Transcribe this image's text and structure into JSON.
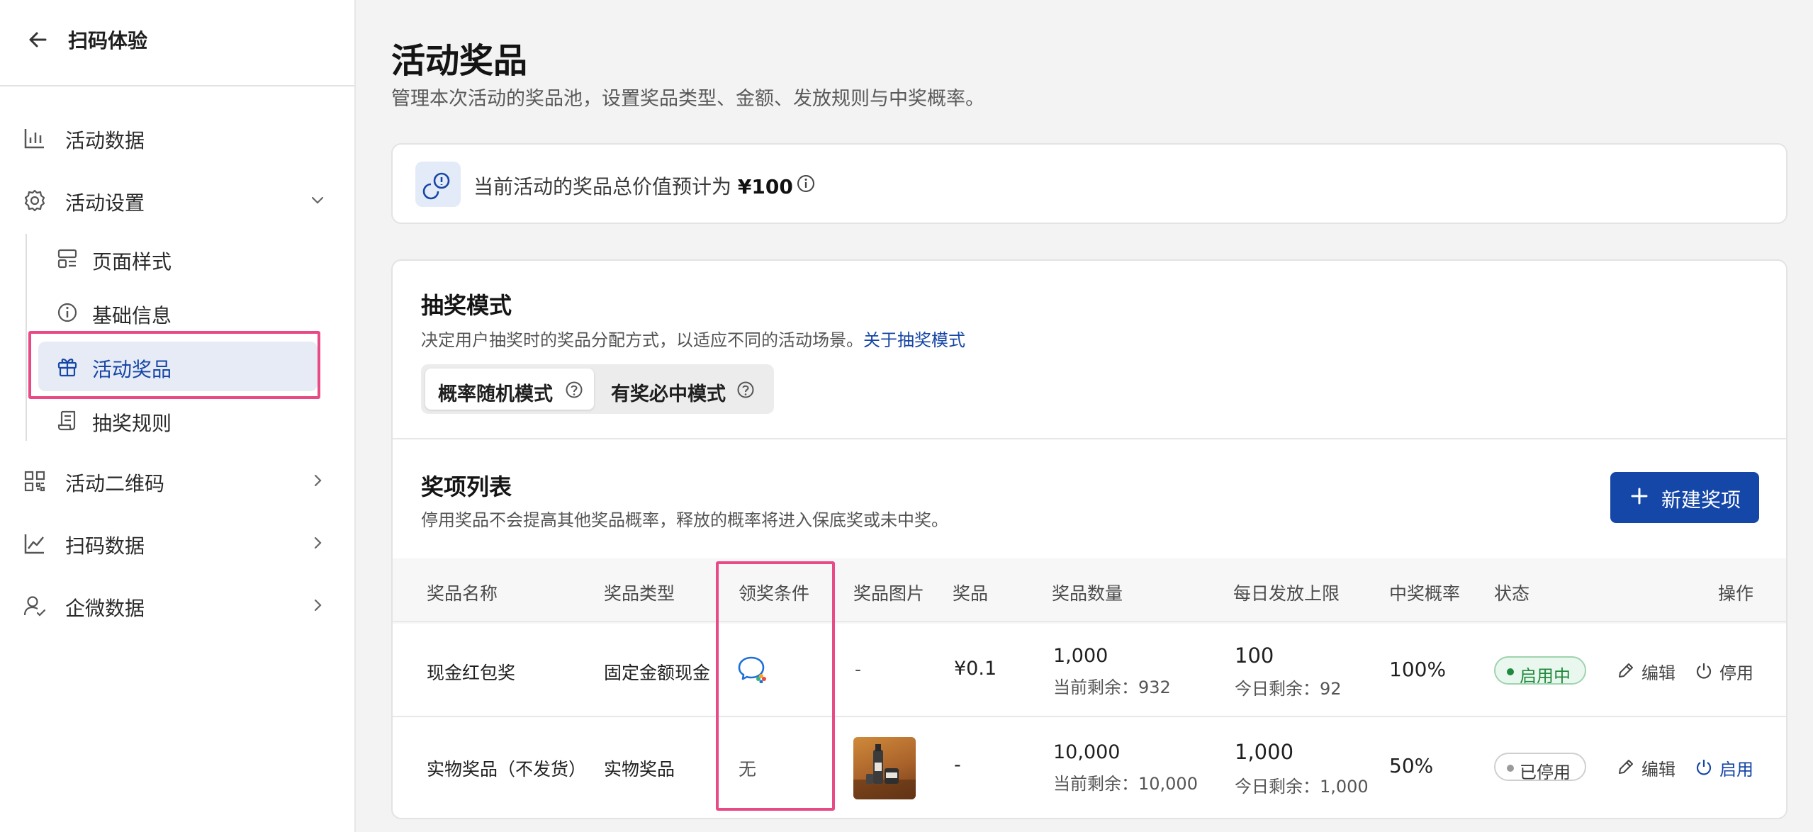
{
  "sidebar": {
    "title": "扫码体验",
    "items": [
      {
        "label": "活动数据"
      },
      {
        "label": "活动设置"
      },
      {
        "label": "活动二维码"
      },
      {
        "label": "扫码数据"
      },
      {
        "label": "企微数据"
      }
    ],
    "sub_items": [
      {
        "label": "页面样式"
      },
      {
        "label": "基础信息"
      },
      {
        "label": "活动奖品"
      },
      {
        "label": "抽奖规则"
      }
    ]
  },
  "page": {
    "title": "活动奖品",
    "subtitle": "管理本次活动的奖品池，设置奖品类型、金额、发放规则与中奖概率。"
  },
  "notice": {
    "text": "当前活动的奖品总价值预计为",
    "amount": "¥100"
  },
  "mode": {
    "title": "抽奖模式",
    "desc": "决定用户抽奖时的奖品分配方式，以适应不同的活动场景。",
    "link": "关于抽奖模式",
    "options": [
      {
        "label": "概率随机模式",
        "selected": true
      },
      {
        "label": "有奖必中模式",
        "selected": false
      }
    ]
  },
  "prize_list": {
    "title": "奖项列表",
    "desc": "停用奖品不会提高其他奖品概率，释放的概率将进入保底奖或未中奖。",
    "new_button": "新建奖项",
    "columns": [
      "奖品名称",
      "奖品类型",
      "领奖条件",
      "奖品图片",
      "奖品",
      "奖品数量",
      "每日发放上限",
      "中奖概率",
      "状态",
      "操作"
    ],
    "rows": [
      {
        "name": "现金红包奖",
        "type": "固定金额现金",
        "condition_icon": "wecom-chat-icon",
        "image": "-",
        "prize": "¥0.1",
        "quantity": "1,000",
        "quantity_remaining": "当前剩余：932",
        "daily_limit": "100",
        "daily_remaining": "今日剩余：92",
        "probability": "100%",
        "status": "启用中",
        "edit": "编辑",
        "toggle": "停用"
      },
      {
        "name": "实物奖品（不发货）",
        "type": "实物奖品",
        "condition": "无",
        "image_icon": "product-bottles-photo",
        "prize": "-",
        "quantity": "10,000",
        "quantity_remaining": "当前剩余：10,000",
        "daily_limit": "1,000",
        "daily_remaining": "今日剩余：1,000",
        "probability": "50%",
        "status": "已停用",
        "edit": "编辑",
        "toggle": "启用"
      }
    ]
  },
  "colors": {
    "accent": "#1547a8",
    "highlight": "#e84a85",
    "active_bg": "#e6ebf6",
    "status_on": "#1f8a3d"
  }
}
